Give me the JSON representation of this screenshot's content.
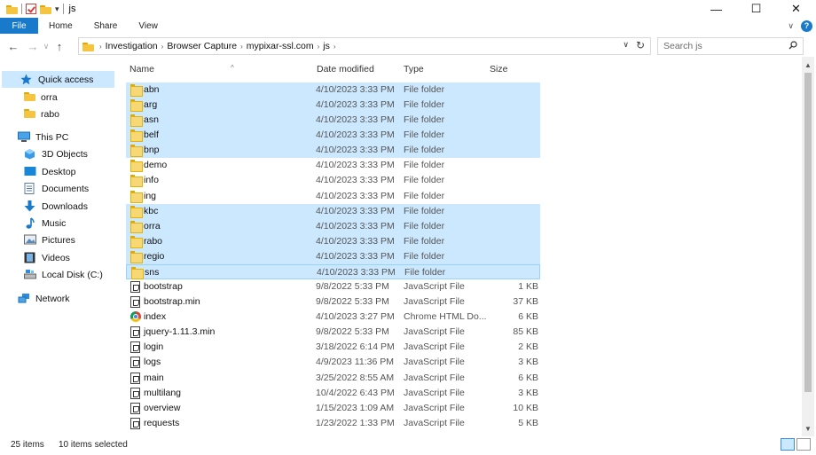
{
  "window": {
    "title": "js",
    "controls": {
      "minimize": "—",
      "maximize": "☐",
      "close": "✕"
    }
  },
  "ribbon": {
    "tabs": [
      "File",
      "Home",
      "Share",
      "View"
    ],
    "help": "?",
    "expand": "∨"
  },
  "address": {
    "back": "←",
    "forward": "→",
    "up": "↑",
    "crumbs": [
      "Investigation",
      "Browser Capture",
      "mypixar-ssl.com",
      "js"
    ],
    "separator": "›",
    "dropdown": "∨",
    "refresh": "↻"
  },
  "search": {
    "placeholder": "Search js"
  },
  "nav": {
    "quick_access": "Quick access",
    "pinned": [
      "orra",
      "rabo"
    ],
    "this_pc": "This PC",
    "pc_items": [
      "3D Objects",
      "Desktop",
      "Documents",
      "Downloads",
      "Music",
      "Pictures",
      "Videos",
      "Local Disk (C:)"
    ],
    "network": "Network"
  },
  "columns": {
    "name": "Name",
    "date": "Date modified",
    "type": "Type",
    "size": "Size"
  },
  "files": [
    {
      "name": "abn",
      "date": "4/10/2023 3:33 PM",
      "type": "File folder",
      "size": "",
      "kind": "folder",
      "selected": true
    },
    {
      "name": "arg",
      "date": "4/10/2023 3:33 PM",
      "type": "File folder",
      "size": "",
      "kind": "folder",
      "selected": true
    },
    {
      "name": "asn",
      "date": "4/10/2023 3:33 PM",
      "type": "File folder",
      "size": "",
      "kind": "folder",
      "selected": true
    },
    {
      "name": "belf",
      "date": "4/10/2023 3:33 PM",
      "type": "File folder",
      "size": "",
      "kind": "folder",
      "selected": true
    },
    {
      "name": "bnp",
      "date": "4/10/2023 3:33 PM",
      "type": "File folder",
      "size": "",
      "kind": "folder",
      "selected": true
    },
    {
      "name": "demo",
      "date": "4/10/2023 3:33 PM",
      "type": "File folder",
      "size": "",
      "kind": "folder",
      "selected": false
    },
    {
      "name": "info",
      "date": "4/10/2023 3:33 PM",
      "type": "File folder",
      "size": "",
      "kind": "folder",
      "selected": false
    },
    {
      "name": "ing",
      "date": "4/10/2023 3:33 PM",
      "type": "File folder",
      "size": "",
      "kind": "folder",
      "selected": false
    },
    {
      "name": "kbc",
      "date": "4/10/2023 3:33 PM",
      "type": "File folder",
      "size": "",
      "kind": "folder",
      "selected": true
    },
    {
      "name": "orra",
      "date": "4/10/2023 3:33 PM",
      "type": "File folder",
      "size": "",
      "kind": "folder",
      "selected": true
    },
    {
      "name": "rabo",
      "date": "4/10/2023 3:33 PM",
      "type": "File folder",
      "size": "",
      "kind": "folder",
      "selected": true
    },
    {
      "name": "regio",
      "date": "4/10/2023 3:33 PM",
      "type": "File folder",
      "size": "",
      "kind": "folder",
      "selected": true
    },
    {
      "name": "sns",
      "date": "4/10/2023 3:33 PM",
      "type": "File folder",
      "size": "",
      "kind": "folder",
      "selected": true
    },
    {
      "name": "bootstrap",
      "date": "9/8/2022 5:33 PM",
      "type": "JavaScript File",
      "size": "1 KB",
      "kind": "js",
      "selected": false
    },
    {
      "name": "bootstrap.min",
      "date": "9/8/2022 5:33 PM",
      "type": "JavaScript File",
      "size": "37 KB",
      "kind": "js",
      "selected": false
    },
    {
      "name": "index",
      "date": "4/10/2023 3:27 PM",
      "type": "Chrome HTML Do...",
      "size": "6 KB",
      "kind": "chrome",
      "selected": false
    },
    {
      "name": "jquery-1.11.3.min",
      "date": "9/8/2022 5:33 PM",
      "type": "JavaScript File",
      "size": "85 KB",
      "kind": "js",
      "selected": false
    },
    {
      "name": "login",
      "date": "3/18/2022 6:14 PM",
      "type": "JavaScript File",
      "size": "2 KB",
      "kind": "js",
      "selected": false
    },
    {
      "name": "logs",
      "date": "4/9/2023 11:36 PM",
      "type": "JavaScript File",
      "size": "3 KB",
      "kind": "js",
      "selected": false
    },
    {
      "name": "main",
      "date": "3/25/2022 8:55 AM",
      "type": "JavaScript File",
      "size": "6 KB",
      "kind": "js",
      "selected": false
    },
    {
      "name": "multilang",
      "date": "10/4/2022 6:43 PM",
      "type": "JavaScript File",
      "size": "3 KB",
      "kind": "js",
      "selected": false
    },
    {
      "name": "overview",
      "date": "1/15/2023 1:09 AM",
      "type": "JavaScript File",
      "size": "10 KB",
      "kind": "js",
      "selected": false
    },
    {
      "name": "requests",
      "date": "1/23/2022 1:33 PM",
      "type": "JavaScript File",
      "size": "5 KB",
      "kind": "js",
      "selected": false
    }
  ],
  "status": {
    "count": "25 items",
    "selected": "10 items selected"
  },
  "colors": {
    "selection": "#cce8ff",
    "file_tab": "#1979ca",
    "folder": "#f8d775"
  },
  "icons": [
    "folder-icon",
    "check-icon",
    "search-icon",
    "star-icon",
    "computer-icon",
    "network-icon",
    "chrome-icon",
    "js-file-icon"
  ]
}
